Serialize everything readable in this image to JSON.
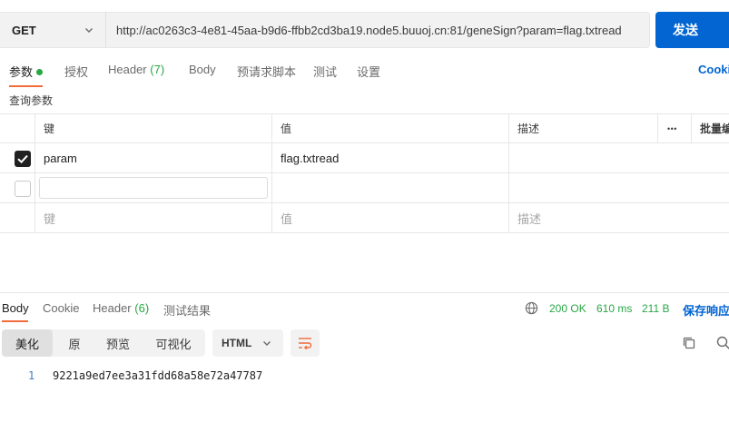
{
  "request": {
    "method": "GET",
    "url": "http://ac0263c3-4e81-45aa-b9d6-ffbb2cd3ba19.node5.buuoj.cn:81/geneSign?param=flag.txtread",
    "send_label": "发送"
  },
  "tabs": {
    "params": "参数",
    "auth": "授权",
    "headers": "Header",
    "headers_count": "(7)",
    "body": "Body",
    "prerequest": "预请求脚本",
    "tests": "测试",
    "settings": "设置",
    "cookies": "Cookies"
  },
  "query_section_label": "查询参数",
  "params_table": {
    "col_key": "键",
    "col_value": "值",
    "col_desc": "描述",
    "more": "•••",
    "bulk_edit": "批量编辑",
    "rows": [
      {
        "checked": true,
        "key": "param",
        "value": "flag.txtread",
        "description": ""
      }
    ],
    "placeholder_key": "键",
    "placeholder_value": "值",
    "placeholder_desc": "描述"
  },
  "response": {
    "tabs": {
      "body": "Body",
      "cookies": "Cookie",
      "headers": "Header",
      "headers_count": "(6)",
      "test_results": "测试结果"
    },
    "status": "200 OK",
    "time": "610 ms",
    "size": "211 B",
    "save_label": "保存响应",
    "view_modes": [
      "美化",
      "原",
      "预览",
      "可视化"
    ],
    "active_view": "美化",
    "format": "HTML",
    "lines": [
      {
        "no": "1",
        "text": "9221a9ed7ee3a31fdd68a58e72a47787"
      }
    ]
  },
  "colors": {
    "accent": "#0265d2",
    "tab_indicator": "#f26b3a",
    "success": "#28a745"
  },
  "icons": [
    "chevron-down-icon",
    "globe-icon",
    "wrap-lines-icon",
    "copy-icon",
    "search-icon"
  ]
}
